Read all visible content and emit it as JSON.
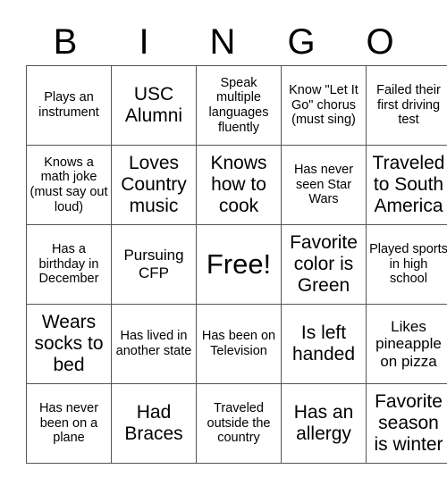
{
  "title_letters": [
    "B",
    "I",
    "N",
    "G",
    "O"
  ],
  "rows": [
    [
      {
        "text": "Plays an instrument",
        "size": "sm"
      },
      {
        "text": "USC Alumni",
        "size": "lg"
      },
      {
        "text": "Speak multiple languages fluently",
        "size": "sm"
      },
      {
        "text": "Know \"Let It Go\" chorus (must sing)",
        "size": "sm"
      },
      {
        "text": "Failed their first driving test",
        "size": "sm"
      }
    ],
    [
      {
        "text": "Knows a math joke (must say out loud)",
        "size": "sm"
      },
      {
        "text": "Loves Country music",
        "size": "lg"
      },
      {
        "text": "Knows how to cook",
        "size": "lg"
      },
      {
        "text": "Has never seen Star Wars",
        "size": "sm"
      },
      {
        "text": "Traveled to South America",
        "size": "lg"
      }
    ],
    [
      {
        "text": "Has a birthday in December",
        "size": "sm"
      },
      {
        "text": "Pursuing CFP",
        "size": "md"
      },
      {
        "text": "Free!",
        "size": "xl"
      },
      {
        "text": "Favorite color is Green",
        "size": "lg"
      },
      {
        "text": "Played sports in high school",
        "size": "sm"
      }
    ],
    [
      {
        "text": "Wears socks to bed",
        "size": "lg"
      },
      {
        "text": "Has lived in another state",
        "size": "sm"
      },
      {
        "text": "Has been on Television",
        "size": "sm"
      },
      {
        "text": "Is left handed",
        "size": "lg"
      },
      {
        "text": "Likes pineapple on pizza",
        "size": "md"
      }
    ],
    [
      {
        "text": "Has never been on a plane",
        "size": "sm"
      },
      {
        "text": "Had Braces",
        "size": "lg"
      },
      {
        "text": "Traveled outside the country",
        "size": "sm"
      },
      {
        "text": "Has an allergy",
        "size": "lg"
      },
      {
        "text": "Favorite season is winter",
        "size": "lg"
      }
    ]
  ]
}
